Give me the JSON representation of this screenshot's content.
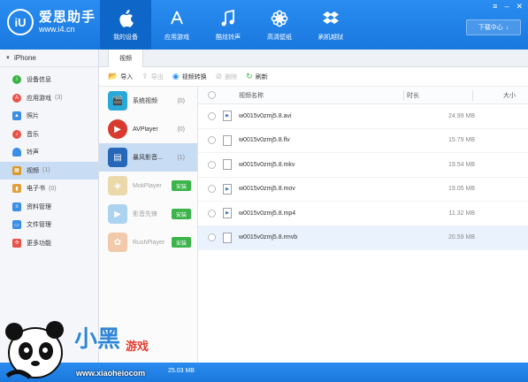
{
  "app": {
    "name": "爱思助手",
    "url": "www.i4.cn",
    "logo_text": "iU"
  },
  "nav": [
    {
      "label": "我的设备",
      "icon": "apple-icon",
      "active": true
    },
    {
      "label": "应用游戏",
      "icon": "app-store-icon",
      "active": false
    },
    {
      "label": "酷炫铃声",
      "icon": "music-note-icon",
      "active": false
    },
    {
      "label": "高清壁纸",
      "icon": "flower-icon",
      "active": false
    },
    {
      "label": "刷机越狱",
      "icon": "dropbox-icon",
      "active": false
    }
  ],
  "download_center": "下载中心",
  "sidebar": {
    "device": "iPhone",
    "items": [
      {
        "label": "设备信息",
        "count": "",
        "icon": "info-icon",
        "color": "#3bb44a"
      },
      {
        "label": "应用游戏",
        "count": "(3)",
        "icon": "apps-icon",
        "color": "#e8524a"
      },
      {
        "label": "照片",
        "count": "",
        "icon": "photo-icon",
        "color": "#3a8ee6"
      },
      {
        "label": "音乐",
        "count": "",
        "icon": "music-icon",
        "color": "#e8524a"
      },
      {
        "label": "铃声",
        "count": "",
        "icon": "bell-icon",
        "color": "#3a8ee6"
      },
      {
        "label": "视频",
        "count": "(1)",
        "icon": "video-icon",
        "color": "#d89a2a"
      },
      {
        "label": "电子书",
        "count": "(0)",
        "icon": "book-icon",
        "color": "#e2a13a"
      },
      {
        "label": "资料管理",
        "count": "",
        "icon": "contacts-icon",
        "color": "#3a8ee6"
      },
      {
        "label": "文件管理",
        "count": "",
        "icon": "folder-icon",
        "color": "#3a8ee6"
      },
      {
        "label": "更多功能",
        "count": "",
        "icon": "more-icon",
        "color": "#e8524a"
      }
    ]
  },
  "tab": "视频",
  "toolbar": {
    "import": "导入",
    "export": "导出",
    "convert": "视频转换",
    "delete": "删除",
    "refresh": "刷新"
  },
  "apps": [
    {
      "name": "系统视频",
      "count": "(0)",
      "install": "",
      "color": "#2aa9d8"
    },
    {
      "name": "AVPlayer",
      "count": "(0)",
      "install": "",
      "color": "#d93a2f"
    },
    {
      "name": "暴风影音...",
      "count": "(1)",
      "install": "",
      "color": "#2667b8"
    },
    {
      "name": "MoliPlayer",
      "count": "",
      "install": "安装",
      "color": "#d8b04a"
    },
    {
      "name": "影音先锋",
      "count": "",
      "install": "安装",
      "color": "#4ea3e0"
    },
    {
      "name": "RushPlayer",
      "count": "",
      "install": "安装",
      "color": "#e8904a"
    }
  ],
  "table": {
    "headers": {
      "name": "视频名称",
      "duration": "时长",
      "size": "大小"
    },
    "rows": [
      {
        "name": "w0015v0zmj5.8.avi",
        "size": "24.99 MB",
        "icon": "video-file-icon"
      },
      {
        "name": "w0015v0zmj5.8.flv",
        "size": "15.79 MB",
        "icon": "file-icon"
      },
      {
        "name": "w0015v0zmj5.8.mkv",
        "size": "19.54 MB",
        "icon": "file-icon"
      },
      {
        "name": "w0015v0zmj5.8.mov",
        "size": "19.05 MB",
        "icon": "video-file-icon"
      },
      {
        "name": "w0015v0zmj5.8.mp4",
        "size": "11.32 MB",
        "icon": "video-file-icon"
      },
      {
        "name": "w0015v0zmj5.8.rmvb",
        "size": "20.59 MB",
        "icon": "file-icon"
      }
    ]
  },
  "status": "25.03 MB",
  "watermark": {
    "title": "小黑",
    "sub": "游戏",
    "url": "www.xiaoheiocom"
  }
}
